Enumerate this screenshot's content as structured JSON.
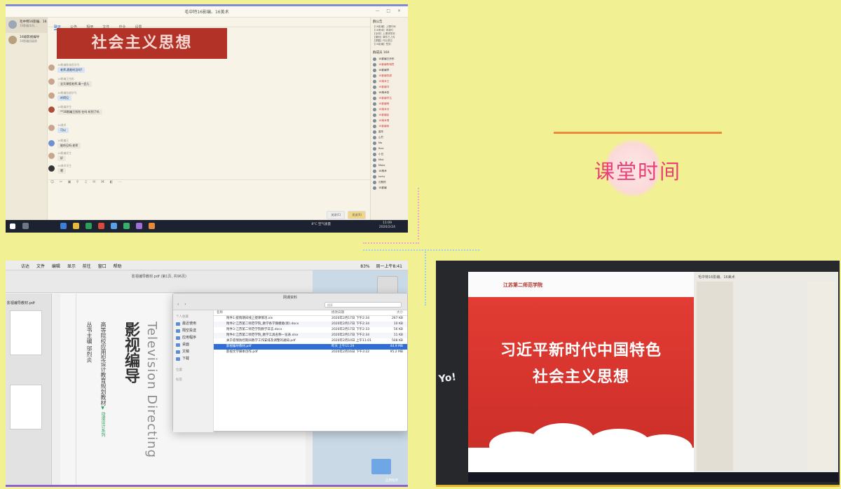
{
  "section_title": "课堂时间",
  "panel1": {
    "window_title": "毛中特16影编、16美术",
    "window_buttons": "— □ ×",
    "conversations": [
      {
        "name": "毛中特16影编、16美术",
        "preview": "16影编本科…"
      },
      {
        "name": "16级影视编导",
        "preview": "16影编班级群"
      }
    ],
    "tabs": [
      "聊天",
      "公告",
      "相册",
      "文件",
      "作业",
      "设置"
    ],
    "slide_caption": "社会主义思想",
    "messages": [
      {
        "sender": "16影编陈瑞思学号",
        "text": "老师,麦能听见吗?"
      },
      {
        "sender": "16影编王彤彤",
        "text": "全天课程老师,请一会儿"
      },
      {
        "sender": "16影编张越学号",
        "text": "听得见"
      },
      {
        "sender": "16影编学生",
        "text": "**16影编王彤彤  在吗 听到了吗"
      },
      {
        "sender": "16美术",
        "text": "可以"
      },
      {
        "sender": "16影编王",
        "text": "能听见吗 老师"
      },
      {
        "sender": "16影编学生",
        "text": "好"
      },
      {
        "sender": "16美术学生",
        "text": "嗯"
      }
    ],
    "toolbar_icons": "☺ ✂ ▣ ⚲ ♫ ✉ ⌘ ◧ ⋯",
    "close_label": "关闭(C)",
    "send_label": "发送(S)",
    "announcement_title": "群公告",
    "announcements": [
      "【16影编】上课时间",
      "【16美术】请准时",
      "【全体】上课请签到",
      "【通知】课件已上传",
      "【提醒】作业提交",
      "【16影编】签到"
    ],
    "members_title": "群成员 160",
    "members": [
      {
        "name": "16影编王彤彤",
        "red": false
      },
      {
        "name": "16影编陈瑞思",
        "red": true
      },
      {
        "name": "16影编李",
        "red": false
      },
      {
        "name": "16影编张越",
        "red": true
      },
      {
        "name": "16美术王",
        "red": true
      },
      {
        "name": "16影编刘",
        "red": true
      },
      {
        "name": "16美术张",
        "red": false
      },
      {
        "name": "16影编学生",
        "red": true
      },
      {
        "name": "16影编杨",
        "red": true
      },
      {
        "name": "16美术孙",
        "red": true
      },
      {
        "name": "16影编赵",
        "red": true
      },
      {
        "name": "16美术周",
        "red": true
      },
      {
        "name": "16影编吴",
        "red": true
      },
      {
        "name": "暮冬",
        "red": false
      },
      {
        "name": "山竹",
        "red": false
      },
      {
        "name": "Mo",
        "red": false
      },
      {
        "name": "Rick",
        "red": false
      },
      {
        "name": "小白",
        "red": false
      },
      {
        "name": "Mist",
        "red": false
      },
      {
        "name": "Moko",
        "red": false
      },
      {
        "name": "16美术",
        "red": false
      },
      {
        "name": "lucky",
        "red": false
      },
      {
        "name": "沉默的",
        "red": false
      },
      {
        "name": "16影编",
        "red": false
      }
    ],
    "clock_time": "11:09",
    "clock_date": "2020/2/24",
    "weather": "8°C 空气质量"
  },
  "panel3": {
    "menubar": [
      "访达",
      "文件",
      "编辑",
      "显示",
      "前往",
      "窗口",
      "帮助"
    ],
    "status": [
      "83%",
      "周一上午8:41"
    ],
    "preview_title": "影视编导教材.pdf (第1页, 共96页)",
    "preview_file": "影视编导教材.pdf",
    "book_title": "影视编导",
    "book_series": "高等院校应用型设计教育规划教材",
    "book_english": "Television Directing",
    "book_author": "丛书主编  邬烈炎",
    "book_series_tag": "▼ 动漫设计系列",
    "finder_title": "网课资料",
    "search_placeholder": "搜索",
    "sidebar_header": "个人收藏",
    "sidebar_items": [
      "最近使用",
      "隔空投送",
      "应用程序",
      "桌面",
      "文稿",
      "下载"
    ],
    "sidebar_loc": "位置",
    "sidebar_tag": "标签",
    "columns": [
      "名称",
      "修改日期",
      "大小"
    ],
    "files": [
      {
        "name": "附件1:疫情期间线上授课情况.xls",
        "date": "2020年2月17日 下午2:34",
        "size": "267 KB",
        "sel": false
      },
      {
        "name": "附件2:江苏第二师范学院_教学各学期模版(新).docx",
        "date": "2020年2月17日 下午2:34",
        "size": "10 KB",
        "sel": false
      },
      {
        "name": "附件3:江苏第二师范学院教学日志.docx",
        "date": "2020年2月17日 下午2:33",
        "size": "56 KB",
        "sel": false
      },
      {
        "name": "附件4:江苏第二师范学院_教学工具名称一览表.xlsx",
        "date": "2020年2月17日 下午2:34",
        "size": "11 KB",
        "sel": false
      },
      {
        "name": "关于疫情防控期间教学工作安排及调整的通知.pdf",
        "date": "2020年2月10日 上午11:01",
        "size": "508 KB",
        "sel": false
      },
      {
        "name": "影视编导教材.pdf",
        "date": "昨天 上午11:29",
        "size": "44.9 MB",
        "sel": true
      },
      {
        "name": "影视文学脚本创作.pdf",
        "date": "2020年2月16日 下午3:22",
        "size": "95.2 MB",
        "sel": false
      }
    ],
    "desktop_folder": "应用程序"
  },
  "panel4": {
    "slide_line1": "习近平新时代中国特色",
    "slide_line2": "社会主义思想",
    "school_name": "江苏第二师范学院",
    "chat_title": "毛中特16影编、16美术",
    "sticker": "Yo!"
  }
}
